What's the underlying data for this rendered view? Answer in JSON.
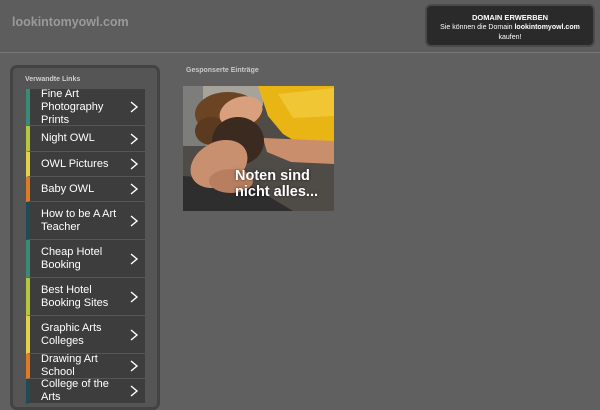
{
  "header": {
    "site_title": "lookintomyowl.com"
  },
  "domain_offer": {
    "title": "DOMAIN ERWERBEN",
    "text_before": "Sie können die Domain ",
    "domain": "lookintomyowl.com",
    "text_after": "kaufen!"
  },
  "sidebar": {
    "title": "Verwandte Links",
    "links": [
      {
        "label": "Fine Art Photography Prints",
        "color": "#3a8a78"
      },
      {
        "label": "Night OWL",
        "color": "#b7c63c"
      },
      {
        "label": "OWL Pictures",
        "color": "#e6d24a"
      },
      {
        "label": "Baby OWL",
        "color": "#e07b25"
      },
      {
        "label": "How to be A Art Teacher",
        "color": "#1f4a56"
      },
      {
        "label": "Cheap Hotel Booking",
        "color": "#3a8a78"
      },
      {
        "label": "Best Hotel Booking Sites",
        "color": "#b7c63c"
      },
      {
        "label": "Graphic Arts Colleges",
        "color": "#e6d24a"
      },
      {
        "label": "Drawing Art School",
        "color": "#e07b25"
      },
      {
        "label": "College of the Arts",
        "color": "#1f4a56"
      }
    ]
  },
  "sponsored": {
    "title": "Gesponserte Einträge",
    "ad_text_line1": "Noten sind",
    "ad_text_line2": "nicht alles..."
  }
}
